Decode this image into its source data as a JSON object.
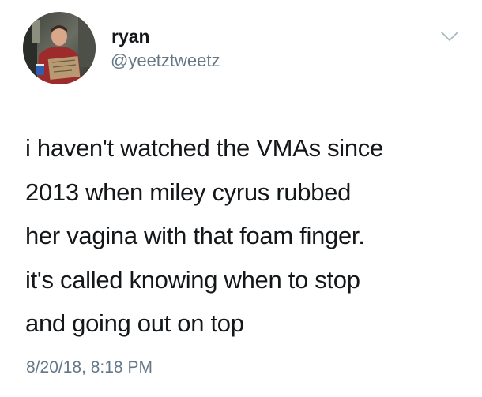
{
  "user": {
    "display_name": "ryan",
    "handle": "@yeetztweetz"
  },
  "tweet": {
    "lines": [
      "i haven't watched the VMAs since",
      "2013 when miley cyrus rubbed",
      "her vagina with that foam finger.",
      "it's called knowing when to stop",
      "and going out on top"
    ],
    "timestamp": "8/20/18, 8:18 PM"
  },
  "icons": {
    "avatar": "profile-photo",
    "menu": "chevron-down-icon"
  },
  "colors": {
    "text": "#14171a",
    "secondary": "#657786",
    "background": "#ffffff"
  }
}
